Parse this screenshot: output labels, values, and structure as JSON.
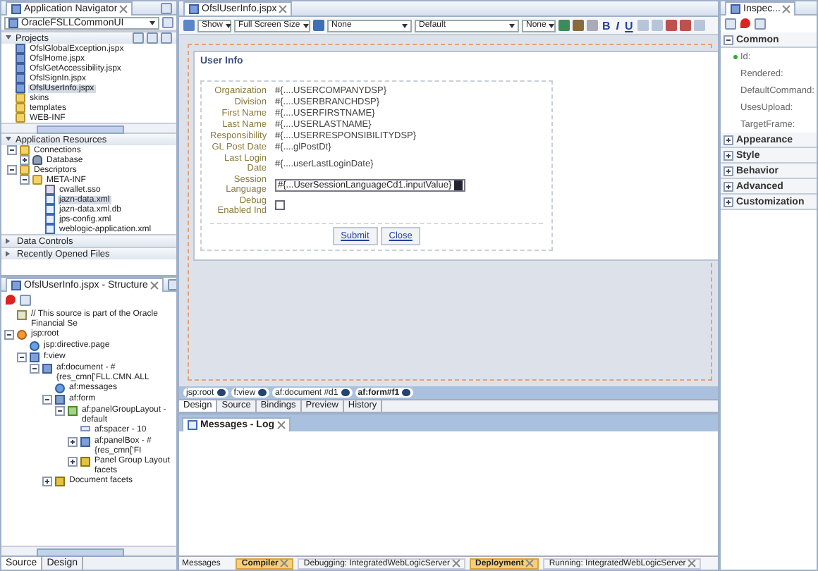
{
  "navigator": {
    "title": "Application Navigator",
    "app": "OracleFSLLCommonUI",
    "projects_label": "Projects",
    "projects": [
      {
        "label": "OfslGlobalException.jspx",
        "kind": "page",
        "selected": false
      },
      {
        "label": "OfslHome.jspx",
        "kind": "page",
        "selected": false
      },
      {
        "label": "OfslGetAccessibility.jspx",
        "kind": "page",
        "selected": false
      },
      {
        "label": "OfslSignIn.jspx",
        "kind": "page",
        "selected": false
      },
      {
        "label": "OfslUserInfo.jspx",
        "kind": "page",
        "selected": true
      },
      {
        "label": "skins",
        "kind": "folder",
        "selected": false
      },
      {
        "label": "templates",
        "kind": "folder",
        "selected": false
      },
      {
        "label": "WEB-INF",
        "kind": "folder",
        "selected": false
      }
    ],
    "resources_label": "Application Resources",
    "resources": [
      {
        "label": "Connections",
        "kind": "folder",
        "expanded": true,
        "selected": false,
        "children": [
          {
            "label": "Database",
            "kind": "db",
            "expanded": false,
            "selected": false
          }
        ]
      },
      {
        "label": "Descriptors",
        "kind": "folder",
        "expanded": true,
        "selected": false,
        "children": [
          {
            "label": "META-INF",
            "kind": "folder",
            "expanded": true,
            "selected": false,
            "children": [
              {
                "label": "cwallet.sso",
                "kind": "file",
                "selected": false
              },
              {
                "label": "jazn-data.xml",
                "kind": "xml",
                "selected": true
              },
              {
                "label": "jazn-data.xml.db",
                "kind": "xml",
                "selected": false
              },
              {
                "label": "jps-config.xml",
                "kind": "xml",
                "selected": false
              },
              {
                "label": "weblogic-application.xml",
                "kind": "xml",
                "selected": false
              }
            ]
          }
        ]
      }
    ],
    "sections": [
      "Data Controls",
      "Recently Opened Files"
    ]
  },
  "structure": {
    "title": "OfslUserInfo.jspx - Structure",
    "tree": [
      {
        "label": "// This source is part of the Oracle Financial Se",
        "kind": "comment"
      },
      {
        "label": "jsp:root",
        "kind": "root",
        "expanded": true,
        "children": [
          {
            "label": "jsp:directive.page",
            "kind": "directive"
          },
          {
            "label": "f:view",
            "kind": "page",
            "expanded": true,
            "children": [
              {
                "label": "af:document - #{res_cmn['FLL.CMN.ALL",
                "kind": "page",
                "expanded": true,
                "children": [
                  {
                    "label": "af:messages",
                    "kind": "directive"
                  },
                  {
                    "label": "af:form",
                    "kind": "page",
                    "expanded": true,
                    "children": [
                      {
                        "label": "af:panelGroupLayout - default",
                        "kind": "layout",
                        "expanded": true,
                        "children": [
                          {
                            "label": "af:spacer - 10",
                            "kind": "spacer"
                          },
                          {
                            "label": "af:panelBox - #{res_cmn['FI",
                            "kind": "page",
                            "expanded": false
                          },
                          {
                            "label": "Panel Group Layout facets",
                            "kind": "facet",
                            "expanded": false
                          }
                        ]
                      }
                    ]
                  },
                  {
                    "label": "Document facets",
                    "kind": "facet",
                    "expanded": false
                  }
                ]
              }
            ]
          }
        ]
      }
    ],
    "tabs": [
      {
        "label": "Source",
        "selected": true
      },
      {
        "label": "Design",
        "selected": false
      }
    ]
  },
  "editor": {
    "tab": "OfslUserInfo.jspx",
    "toolbar": {
      "show": "Show",
      "size": "Full Screen Size",
      "style": "None",
      "font": "Default",
      "font_size": "None",
      "format": [
        "B",
        "I",
        "U"
      ]
    },
    "panel_title": "User Info",
    "fields": [
      {
        "label": "Organization",
        "kind": "text",
        "value": "#{....USERCOMPANYDSP}"
      },
      {
        "label": "Division",
        "kind": "text",
        "value": "#{....USERBRANCHDSP}"
      },
      {
        "label": "First Name",
        "kind": "text",
        "value": "#{....USERFIRSTNAME}"
      },
      {
        "label": "Last Name",
        "kind": "text",
        "value": "#{....USERLASTNAME}"
      },
      {
        "label": "Responsibility",
        "kind": "text",
        "value": "#{....USERRESPONSIBILITYDSP}"
      },
      {
        "label": "GL Post Date",
        "kind": "text",
        "value": "#{....glPostDt}"
      },
      {
        "label": "Last Login Date",
        "kind": "text",
        "value": "#{....userLastLoginDate}"
      },
      {
        "label": "Session Language",
        "kind": "select",
        "value": "#{...UserSessionLanguageCd1.inputValue}"
      },
      {
        "label": "Debug Enabled Ind",
        "kind": "checkbox",
        "checked": false
      }
    ],
    "buttons": [
      "Submit",
      "Close"
    ],
    "breadcrumb": [
      "jsp:root",
      "f:view",
      "af:document #d1",
      "af:form#f1"
    ],
    "view_tabs": [
      {
        "label": "Design",
        "selected": true
      },
      {
        "label": "Source",
        "selected": false
      },
      {
        "label": "Bindings",
        "selected": false
      },
      {
        "label": "Preview",
        "selected": false
      },
      {
        "label": "History",
        "selected": false
      }
    ]
  },
  "log": {
    "title": "Messages - Log",
    "messages_label": "Messages",
    "tabs": [
      {
        "label": "Compiler",
        "highlighted": true
      },
      {
        "label": "Debugging: IntegratedWebLogicServer",
        "highlighted": false
      },
      {
        "label": "Deployment",
        "highlighted": true
      },
      {
        "label": "Running: IntegratedWebLogicServer",
        "highlighted": false
      }
    ]
  },
  "inspector": {
    "title": "Inspec...",
    "sections": [
      {
        "label": "Common",
        "expanded": true,
        "props": [
          "Id:",
          "Rendered:",
          "DefaultCommand:",
          "UsesUpload:",
          "TargetFrame:"
        ]
      },
      {
        "label": "Appearance",
        "expanded": false
      },
      {
        "label": "Style",
        "expanded": false
      },
      {
        "label": "Behavior",
        "expanded": false
      },
      {
        "label": "Advanced",
        "expanded": false
      },
      {
        "label": "Customization",
        "expanded": false
      }
    ]
  }
}
